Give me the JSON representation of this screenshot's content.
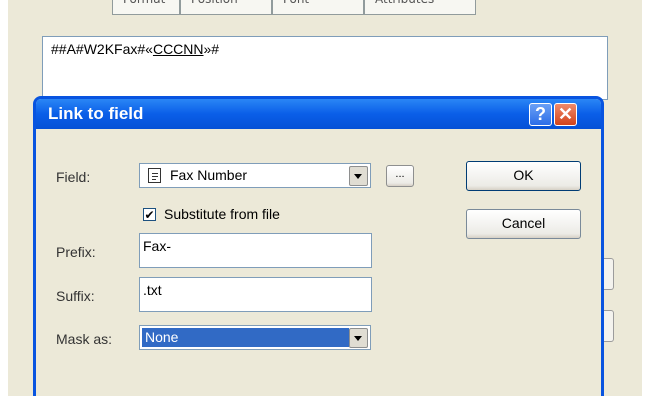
{
  "background": {
    "tabs": [
      "Format",
      "Position",
      "Font",
      "Attributes"
    ],
    "field_text_prefix": "##A#W2KFax#«",
    "field_text_link": "CCCNN",
    "field_text_suffix": "»#"
  },
  "dialog": {
    "title": "Link to field",
    "help_button": "?",
    "close_button": "✕",
    "field": {
      "label": "Field:",
      "value": "Fax Number",
      "icon": "document-icon",
      "browse_label": "..."
    },
    "substitute": {
      "label": "Substitute from file",
      "checked": true,
      "checkmark": "✔"
    },
    "prefix": {
      "label": "Prefix:",
      "value": "Fax-"
    },
    "suffix": {
      "label": "Suffix:",
      "value": ".txt"
    },
    "mask": {
      "label": "Mask as:",
      "value": "None"
    },
    "ok_label": "OK",
    "cancel_label": "Cancel"
  },
  "colors": {
    "titlebar": "#0a5ee8",
    "selection": "#316ac5",
    "dialog_bg": "#ece9d8"
  }
}
